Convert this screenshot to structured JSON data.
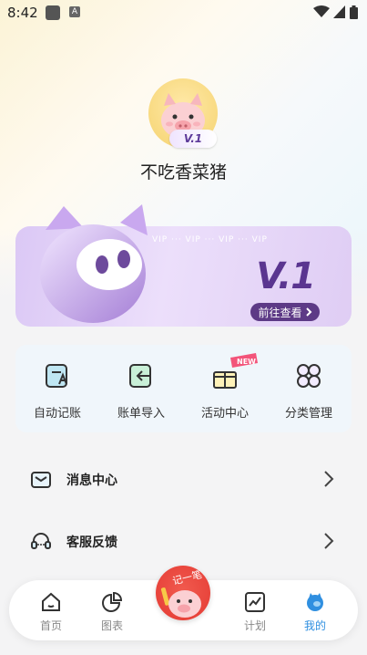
{
  "status_bar": {
    "time": "8:42",
    "notification_icon_b": "A"
  },
  "profile": {
    "username": "不吃香菜猪",
    "vip_level_badge": "V.1"
  },
  "vip_card": {
    "strip_text": "VIP  ···  VIP  ···  VIP  ···  VIP",
    "level": "V.1",
    "link_label": "前往查看"
  },
  "quick_actions": [
    {
      "label": "自动记账",
      "icon": "auto-bookkeeping-icon"
    },
    {
      "label": "账单导入",
      "icon": "bill-import-icon"
    },
    {
      "label": "活动中心",
      "icon": "gift-box-icon",
      "badge": "NEW"
    },
    {
      "label": "分类管理",
      "icon": "category-grid-icon"
    }
  ],
  "menu": [
    {
      "label": "消息中心",
      "icon": "mail-icon"
    },
    {
      "label": "客服反馈",
      "icon": "headset-icon"
    }
  ],
  "bottom_nav": {
    "items": [
      {
        "label": "首页",
        "icon": "home-icon",
        "active": false
      },
      {
        "label": "图表",
        "icon": "pie-chart-icon",
        "active": false
      },
      {
        "label": "计划",
        "icon": "trend-icon",
        "active": false
      },
      {
        "label": "我的",
        "icon": "profile-icon",
        "active": true
      }
    ],
    "record_label": "记一笔"
  },
  "colors": {
    "accent": "#2f8fe0",
    "vip_purple": "#5d3a86",
    "record_red": "#e43a33"
  }
}
